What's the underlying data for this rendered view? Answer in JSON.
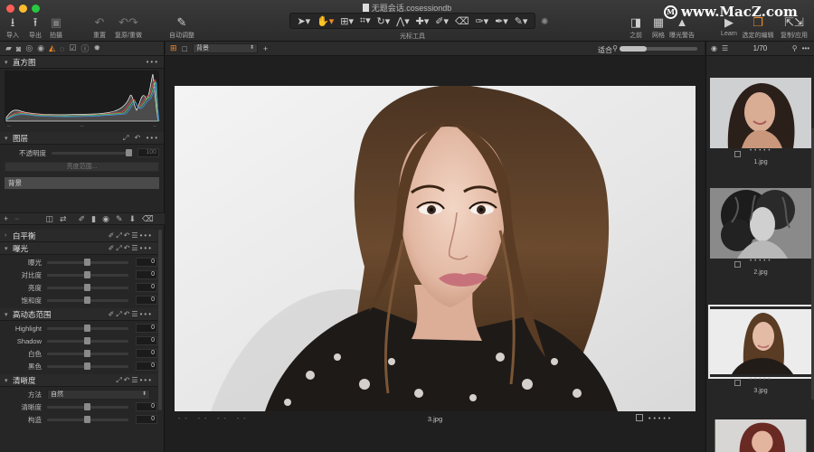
{
  "window": {
    "title": "无题会话.cosessiondb"
  },
  "watermark": "www.MacZ.com",
  "toolbar": {
    "left": [
      {
        "icon": "import-icon",
        "label": "导入"
      },
      {
        "icon": "export-icon",
        "label": "导出"
      },
      {
        "icon": "camera-icon",
        "label": "拍摄"
      },
      {
        "icon": "reset-icon",
        "label": "重置"
      },
      {
        "icon": "copy-apply-icon",
        "label": "复原/重做"
      },
      {
        "icon": "auto-adjust-icon",
        "label": "自动调整"
      }
    ],
    "cursor_label": "光标工具",
    "right": [
      {
        "icon": "before-icon",
        "label": "之前"
      },
      {
        "icon": "grid-icon",
        "label": "网格"
      },
      {
        "icon": "exposure-warning-icon",
        "label": "曝光警告"
      },
      {
        "icon": "learn-icon",
        "label": "Learn"
      },
      {
        "icon": "selected-edit-icon",
        "label": "选定的编辑"
      },
      {
        "icon": "copy-apply-icon",
        "label": "复制/应用"
      }
    ]
  },
  "histogram": {
    "title": "直方图",
    "ticks": [
      "--",
      "--",
      "--"
    ]
  },
  "layers": {
    "title": "图层",
    "opacity_label": "不透明度",
    "opacity_value": "100",
    "range_button": "亮度范围...",
    "layer_name": "背景"
  },
  "white_balance": {
    "title": "白平衡"
  },
  "exposure": {
    "title": "曝光",
    "rows": [
      {
        "label": "曝光",
        "value": "0"
      },
      {
        "label": "对比度",
        "value": "0"
      },
      {
        "label": "亮度",
        "value": "0"
      },
      {
        "label": "饱和度",
        "value": "0"
      }
    ]
  },
  "hdr": {
    "title": "高动态范围",
    "rows": [
      {
        "label": "Highlight",
        "value": "0"
      },
      {
        "label": "Shadow",
        "value": "0"
      },
      {
        "label": "白色",
        "value": "0"
      },
      {
        "label": "黑色",
        "value": "0"
      }
    ]
  },
  "clarity": {
    "title": "清晰度",
    "method_label": "方法",
    "method_value": "自然",
    "rows": [
      {
        "label": "清晰度",
        "value": "0"
      },
      {
        "label": "构造",
        "value": "0"
      }
    ]
  },
  "viewer": {
    "layer_select": "背景",
    "fit_label": "适合",
    "meta": "-- -- -- --",
    "filename": "3.jpg"
  },
  "browser": {
    "count": "1/70",
    "thumbs": [
      {
        "name": "1.jpg"
      },
      {
        "name": "2.jpg"
      },
      {
        "name": "3.jpg"
      }
    ]
  }
}
